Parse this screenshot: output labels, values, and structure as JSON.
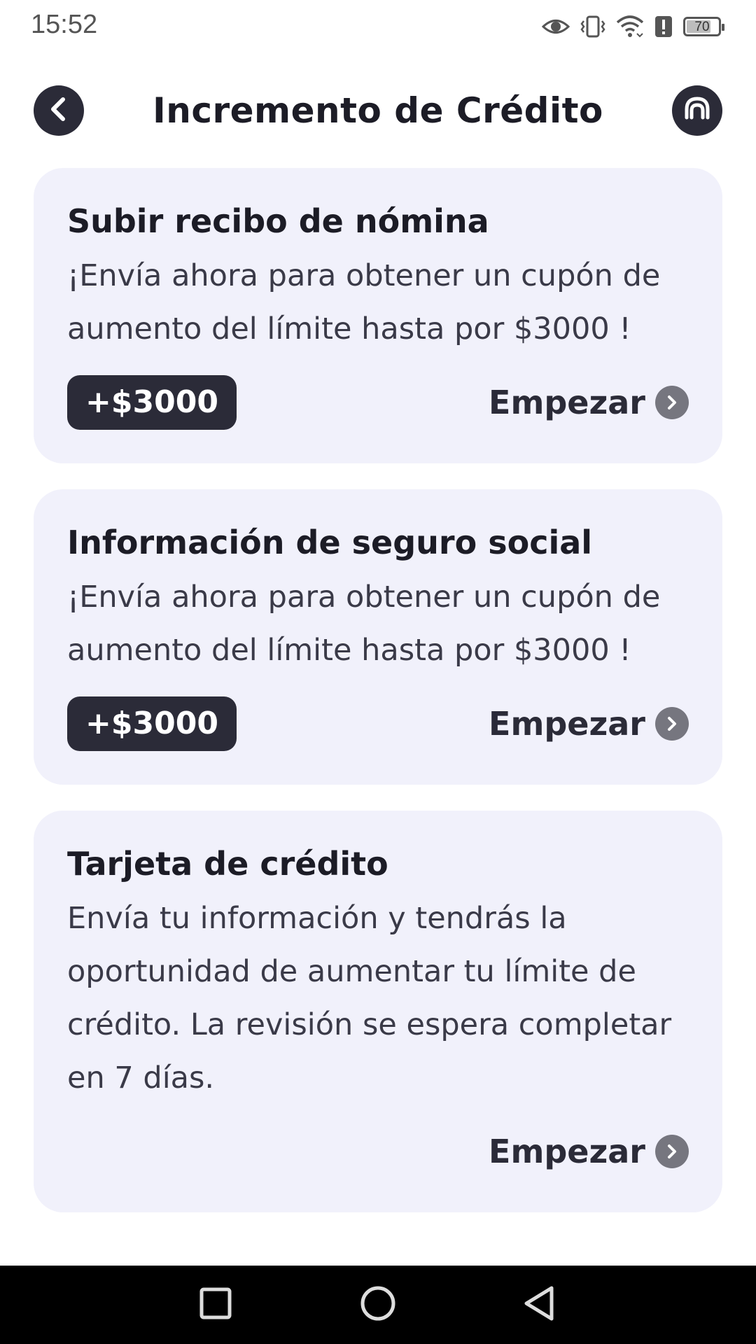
{
  "status_bar": {
    "time": "15:52",
    "battery": "70",
    "icons": [
      "eye-icon",
      "vibrate-icon",
      "wifi-icon",
      "alert-icon",
      "battery-icon"
    ]
  },
  "header": {
    "title": "Incremento de Crédito",
    "back_icon": "chevron-left-icon",
    "support_icon": "headset-icon"
  },
  "cards": [
    {
      "title": "Subir recibo de nómina",
      "description": "¡Envía ahora para obtener un cupón de aumento del límite hasta por $3000 !",
      "amount": "+$3000",
      "action": "Empezar"
    },
    {
      "title": "Información de seguro social",
      "description": "¡Envía ahora para obtener un cupón de aumento del límite hasta por $3000 !",
      "amount": "+$3000",
      "action": "Empezar"
    },
    {
      "title": "Tarjeta de crédito",
      "description": "Envía tu información y tendrás la oportunidad de aumentar tu límite de crédito. La revisión se espera completar en 7 días.",
      "action": "Empezar"
    }
  ],
  "nav_bar": {
    "icons": [
      "recents-square-icon",
      "home-circle-icon",
      "back-triangle-icon"
    ]
  },
  "colors": {
    "card_bg": "#f1f1fb",
    "dark": "#2b2b38",
    "arrow_bg": "#76767f"
  }
}
